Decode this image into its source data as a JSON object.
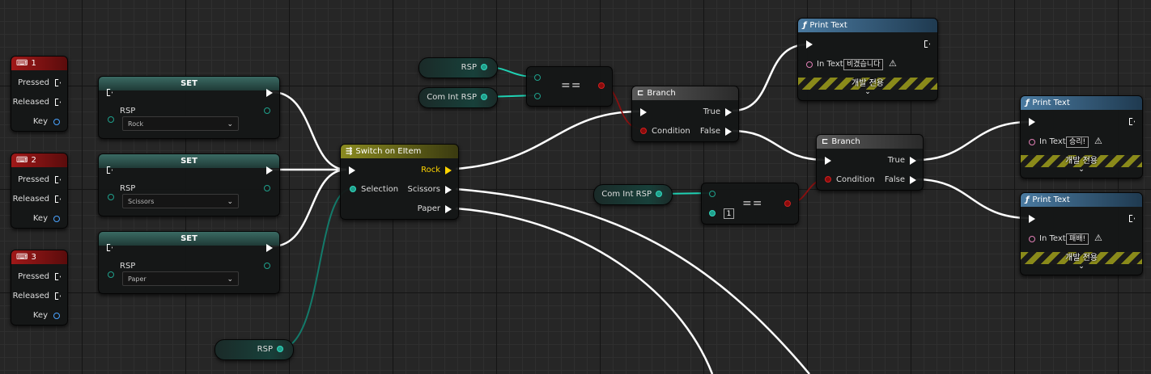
{
  "key_events": [
    {
      "key": "1",
      "pressed": "Pressed",
      "released": "Released",
      "key_label": "Key"
    },
    {
      "key": "2",
      "pressed": "Pressed",
      "released": "Released",
      "key_label": "Key"
    },
    {
      "key": "3",
      "pressed": "Pressed",
      "released": "Released",
      "key_label": "Key"
    }
  ],
  "set_nodes": [
    {
      "title": "SET",
      "var": "RSP",
      "value": "Rock"
    },
    {
      "title": "SET",
      "var": "RSP",
      "value": "Scissors"
    },
    {
      "title": "SET",
      "var": "RSP",
      "value": "Paper"
    }
  ],
  "rsp_getter": "RSP",
  "switch_node": {
    "title": "Switch on EItem",
    "selection": "Selection",
    "outputs": [
      "Rock",
      "Scissors",
      "Paper"
    ]
  },
  "top_getters": {
    "rsp": "RSP",
    "com": "Com Int RSP"
  },
  "equal_op": "==",
  "branch1": {
    "title": "Branch",
    "condition": "Condition",
    "true": "True",
    "false": "False"
  },
  "print1": {
    "title": "Print Text",
    "in_text": "In Text",
    "value": "비겼습니다",
    "dev_only": "개발 전용"
  },
  "com_getter2": "Com Int RSP",
  "equal2": {
    "op": "==",
    "number": "1"
  },
  "branch2": {
    "title": "Branch",
    "condition": "Condition",
    "true": "True",
    "false": "False"
  },
  "print2": {
    "title": "Print Text",
    "in_text": "In Text",
    "value": "승리!",
    "dev_only": "개발 전용"
  },
  "print3": {
    "title": "Print Text",
    "in_text": "In Text",
    "value": "패배!",
    "dev_only": "개발 전용"
  },
  "colors": {
    "exec_wire": "#ffffff",
    "teal_pin": "#1fa08c",
    "bool_pin": "#8a0b0b",
    "key_header": "#8c1414",
    "set_header": "#2b4a45",
    "switch_header": "#7a7a1e",
    "print_header": "#2f5a78",
    "branch_header": "#4a4a4a"
  },
  "icons": {
    "keyboard": "keyboard-icon",
    "function": "function-icon",
    "branch": "branch-icon",
    "switch": "switch-icon",
    "warning": "warning-icon",
    "chevron": "chevron-down-icon"
  }
}
